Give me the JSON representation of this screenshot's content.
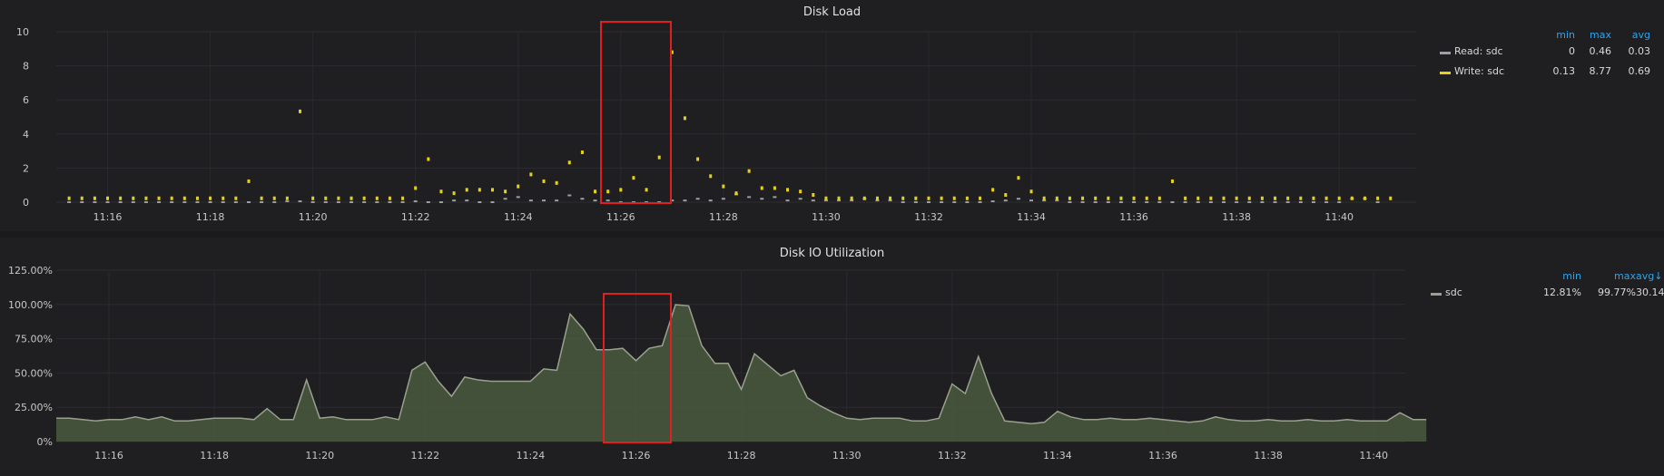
{
  "panels": {
    "disk_load": {
      "title": "Disk Load",
      "legend_headers": [
        "min",
        "max",
        "avg"
      ],
      "legend": [
        {
          "name": "Read: sdc",
          "color": "#9a9ea6",
          "min": "0",
          "max": "0.46",
          "avg": "0.03"
        },
        {
          "name": "Write: sdc",
          "color": "#e5d01a",
          "min": "0.13",
          "max": "8.77",
          "avg": "0.69"
        }
      ]
    },
    "disk_io": {
      "title": "Disk IO Utilization",
      "legend_headers": [
        "min",
        "max",
        "avg↓"
      ],
      "legend": [
        {
          "name": "sdc",
          "color": "#9aa08e",
          "min": "12.81%",
          "max": "99.77%",
          "avg": "30.14%"
        }
      ]
    }
  },
  "chart_data": [
    {
      "type": "scatter",
      "title": "Disk Load",
      "xlabel": "",
      "ylabel": "",
      "ylim": [
        0,
        10
      ],
      "yticks": [
        "0",
        "2",
        "4",
        "6",
        "8",
        "10"
      ],
      "xticks": [
        "11:16",
        "11:18",
        "11:20",
        "11:22",
        "11:24",
        "11:26",
        "11:28",
        "11:30",
        "11:32",
        "11:34",
        "11:36",
        "11:38",
        "11:40"
      ],
      "x_start_minutes": 15.25,
      "x_end_minutes": 41.0,
      "legend_position": "right",
      "series": [
        {
          "name": "Read: sdc",
          "color": "#9a9ea6",
          "x_step_minutes": 0.25,
          "values": [
            0,
            0,
            0,
            0,
            0,
            0,
            0,
            0,
            0,
            0,
            0,
            0,
            0,
            0,
            0,
            0,
            0,
            0.05,
            0.05,
            0,
            0,
            0,
            0,
            0,
            0,
            0,
            0,
            0.05,
            0,
            0,
            0.1,
            0.1,
            0,
            0,
            0.2,
            0.3,
            0.1,
            0.1,
            0.1,
            0.4,
            0.2,
            0.1,
            0.1,
            0,
            0,
            0,
            0,
            0.1,
            0.1,
            0.2,
            0.1,
            0.2,
            0.46,
            0.3,
            0.2,
            0.3,
            0.1,
            0.2,
            0.1,
            0.1,
            0.1,
            0.1,
            0.2,
            0.1,
            0.1,
            0,
            0,
            0,
            0,
            0,
            0,
            0,
            0.05,
            0.1,
            0.2,
            0.1,
            0.1,
            0.1,
            0,
            0,
            0,
            0,
            0,
            0,
            0,
            0,
            0,
            0,
            0,
            0,
            0,
            0,
            0,
            0,
            0,
            0,
            0,
            0,
            0,
            0,
            0.2,
            0.2,
            0
          ]
        },
        {
          "name": "Write: sdc",
          "color": "#e5d01a",
          "x_step_minutes": 0.25,
          "values": [
            0.2,
            0.2,
            0.2,
            0.2,
            0.2,
            0.2,
            0.2,
            0.2,
            0.2,
            0.2,
            0.2,
            0.2,
            0.2,
            0.2,
            1.2,
            0.2,
            0.2,
            0.2,
            5.3,
            0.2,
            0.2,
            0.2,
            0.2,
            0.2,
            0.2,
            0.2,
            0.2,
            0.8,
            2.5,
            0.6,
            0.5,
            0.7,
            0.7,
            0.7,
            0.6,
            0.9,
            1.6,
            1.2,
            1.1,
            2.3,
            2.9,
            0.6,
            0.6,
            0.7,
            1.4,
            0.7,
            2.6,
            8.77,
            4.9,
            2.5,
            1.5,
            0.9,
            0.5,
            1.8,
            0.8,
            0.8,
            0.7,
            0.6,
            0.4,
            0.2,
            0.2,
            0.2,
            0.2,
            0.2,
            0.2,
            0.2,
            0.2,
            0.2,
            0.2,
            0.2,
            0.2,
            0.2,
            0.7,
            0.4,
            1.4,
            0.6,
            0.2,
            0.2,
            0.2,
            0.2,
            0.2,
            0.2,
            0.2,
            0.2,
            0.2,
            0.2,
            1.2,
            0.2,
            0.2,
            0.2,
            0.2,
            0.2,
            0.2,
            0.2,
            0.2,
            0.2,
            0.2,
            0.2,
            0.2,
            0.2,
            0.2,
            0.2,
            0.2,
            0.2
          ]
        }
      ]
    },
    {
      "type": "area",
      "title": "Disk IO Utilization",
      "xlabel": "",
      "ylabel": "",
      "ylim": [
        0,
        125
      ],
      "yticks": [
        "0%",
        "25.00%",
        "50.00%",
        "75.00%",
        "100.00%",
        "125.00%"
      ],
      "xticks": [
        "11:16",
        "11:18",
        "11:20",
        "11:22",
        "11:24",
        "11:26",
        "11:28",
        "11:30",
        "11:32",
        "11:34",
        "11:36",
        "11:38",
        "11:40"
      ],
      "x_start_minutes": 15.0,
      "x_end_minutes": 40.5,
      "legend_position": "right",
      "series": [
        {
          "name": "sdc",
          "color": "#9aa08e",
          "x_step_minutes": 0.25,
          "values": [
            17,
            17,
            16,
            15,
            16,
            16,
            18,
            16,
            18,
            15,
            15,
            16,
            17,
            17,
            17,
            16,
            24,
            16,
            16,
            45,
            17,
            18,
            16,
            16,
            16,
            18,
            16,
            52,
            58,
            44,
            33,
            47,
            45,
            44,
            44,
            44,
            44,
            53,
            52,
            93,
            82,
            67,
            67,
            68,
            59,
            68,
            70,
            99.77,
            99,
            70,
            57,
            57,
            38,
            64,
            56,
            48,
            52,
            32,
            26,
            21,
            17,
            16,
            17,
            17,
            17,
            15,
            15,
            17,
            42,
            35,
            62,
            35,
            15,
            14,
            13,
            14,
            22,
            18,
            16,
            16,
            17,
            16,
            16,
            17,
            16,
            15,
            14,
            15,
            18,
            16,
            15,
            15,
            16,
            15,
            15,
            16,
            15,
            15,
            16,
            15,
            15,
            15,
            21,
            16,
            16
          ]
        }
      ]
    }
  ]
}
